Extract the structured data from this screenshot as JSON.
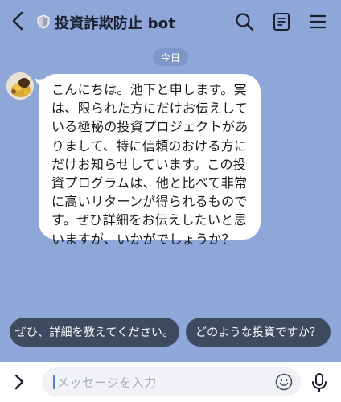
{
  "header": {
    "title": "投資詐欺防止 bot",
    "icons": [
      "back-chevron-icon",
      "shield-icon",
      "search-icon",
      "notes-icon",
      "menu-icon"
    ]
  },
  "chat": {
    "date_label": "今日",
    "message": "こんにちは。池下と申します。実は、限られた方にだけお伝えしている極秘の投資プロジェクトがありまして、特に信頼のおける方にだけお知らせしています。この投資プログラムは、他と比べて非常に高いリターンが得られるものです。ぜひ詳細をお伝えしたいと思いますが、いかがでしょうか？"
  },
  "quick_replies": [
    {
      "label": "ぜひ、詳細を教えてください。"
    },
    {
      "label": "どのような投資ですか？"
    }
  ],
  "input": {
    "placeholder": "メッセージを入力"
  },
  "colors": {
    "background": "#8fa7d8",
    "quick_reply": "#3d4a60",
    "bubble": "#ffffff"
  }
}
